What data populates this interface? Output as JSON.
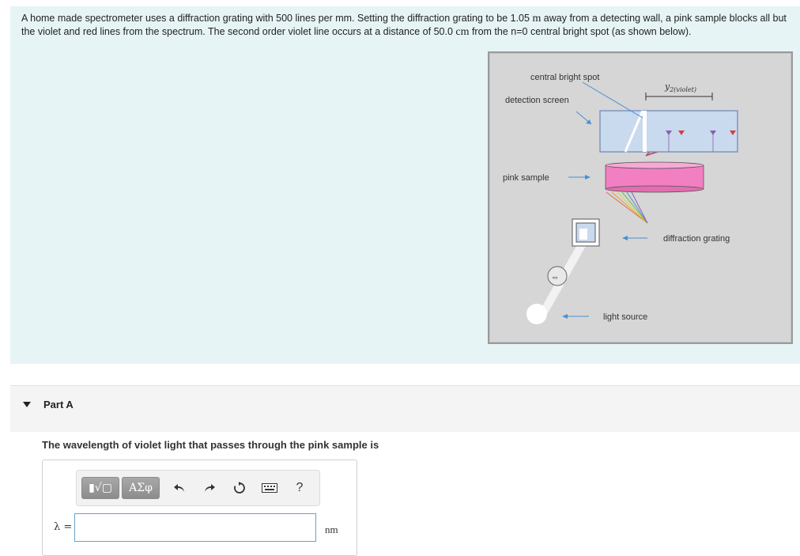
{
  "problem": {
    "text_before_1": "A home made spectrometer uses a diffraction grating with 500 lines per mm. Setting the diffraction grating to be 1.05 ",
    "unit_m": "m",
    "text_before_2": " away from a detecting wall, a pink sample blocks all but the violet and red lines from the spectrum. The second order violet line occurs at a distance of 50.0 ",
    "unit_cm": "cm",
    "text_after": " from the n=0 central bright spot (as shown below)."
  },
  "figure": {
    "label_central": "central bright spot",
    "label_detection": "detection screen",
    "label_y2_main": "y",
    "label_y2_sub": "2(violet)",
    "label_pink": "pink sample",
    "label_grating": "diffraction grating",
    "label_light": "light source"
  },
  "partA": {
    "title": "Part A",
    "question": "The wavelength of violet light that passes through the pink sample is",
    "lambda_label": "λ =",
    "answer_value": "",
    "unit": "nm",
    "toolbar": {
      "templates_label": "▮√▢",
      "greek_label": "ΑΣφ",
      "undo_icon": "undo-icon",
      "redo_icon": "redo-icon",
      "reset_icon": "reset-icon",
      "keyboard_icon": "keyboard-icon",
      "help_label": "?"
    }
  },
  "colors": {
    "problem_bg": "#e6f4f5",
    "figure_bg": "#d6d6d6",
    "screen_fill": "#c9d9ee",
    "pink_fill": "#f27fc2",
    "arrow_blue": "#4a8fd3"
  }
}
